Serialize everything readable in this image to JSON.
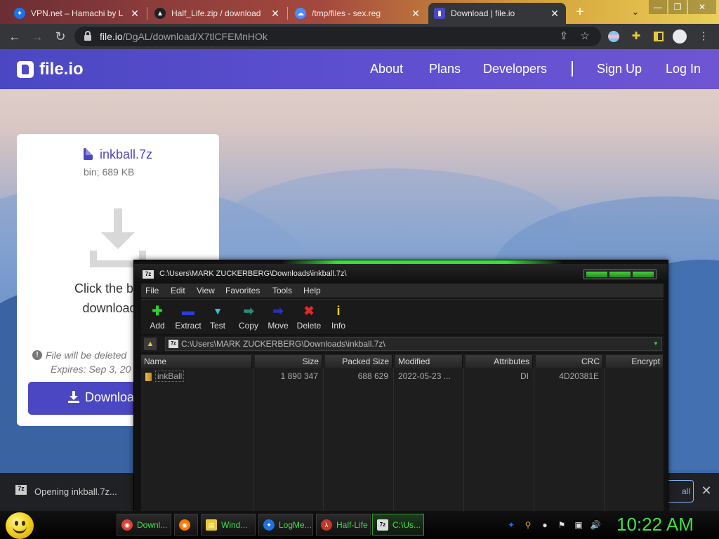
{
  "browser": {
    "tabs": [
      {
        "title": "VPN.net – Hamachi by L",
        "color": "#1a73e8",
        "glyph": "✦"
      },
      {
        "title": "Half_Life.zip / download",
        "color": "#202124",
        "glyph": "▲"
      },
      {
        "title": "/tmp/files - sex.reg",
        "color": "#4a8cff",
        "glyph": "☁"
      },
      {
        "title": "Download | file.io",
        "color": "#4b47c2",
        "glyph": "▮"
      }
    ],
    "new_tab": "+",
    "url_host": "file.io",
    "url_path": "/DgAL/download/X7tlCFEMnHOk"
  },
  "fileio": {
    "brand": "file.io",
    "nav": {
      "about": "About",
      "plans": "Plans",
      "developers": "Developers",
      "signup": "Sign Up",
      "login": "Log In"
    },
    "file_name": "inkball.7z",
    "file_meta": "bin; 689 KB",
    "click_text": "Click the button\ndownload yo",
    "delete_note": "File will be deleted",
    "expires": "Expires: Sep 3, 20",
    "download_btn": "Download"
  },
  "shelf": {
    "item": "Opening inkball.7z...",
    "show_all": "all",
    "close": "✕"
  },
  "sevenzip": {
    "title": "C:\\Users\\MARK ZUCKERBERG\\Downloads\\inkball.7z\\",
    "menu": [
      "File",
      "Edit",
      "View",
      "Favorites",
      "Tools",
      "Help"
    ],
    "tools": [
      {
        "label": "Add",
        "icon": "plus-icon",
        "glyph": "✚",
        "color": "#2fd12f"
      },
      {
        "label": "Extract",
        "icon": "extract-icon",
        "glyph": "▬",
        "color": "#2b3ed6"
      },
      {
        "label": "Test",
        "icon": "test-icon",
        "glyph": "▼",
        "color": "#2bc9d8"
      },
      {
        "label": "Copy",
        "icon": "copy-icon",
        "glyph": "➡",
        "color": "#2a8a7a"
      },
      {
        "label": "Move",
        "icon": "move-icon",
        "glyph": "➡",
        "color": "#2b2fb8"
      },
      {
        "label": "Delete",
        "icon": "delete-icon",
        "glyph": "✖",
        "color": "#e02a2a"
      },
      {
        "label": "Info",
        "icon": "info-icon",
        "glyph": "i",
        "color": "#f0d400"
      }
    ],
    "path": "C:\\Users\\MARK ZUCKERBERG\\Downloads\\inkball.7z\\",
    "columns": [
      "Name",
      "Size",
      "Packed Size",
      "Modified",
      "Attributes",
      "CRC",
      "Encrypt"
    ],
    "rows": [
      {
        "name": "inkBall",
        "size": "1 890 347",
        "packed": "688 629",
        "modified": "2022-05-23 ...",
        "attributes": "DI",
        "crc": "4D20381E",
        "encrypted": ""
      }
    ]
  },
  "taskbar": {
    "tasks": [
      {
        "label": "Downl...",
        "color": "#db4437",
        "glyph": "◉"
      },
      {
        "label": "",
        "color": "#ff7a00",
        "glyph": "◉"
      },
      {
        "label": "Wind...",
        "color": "#e6c93a",
        "glyph": "▤"
      },
      {
        "label": "LogMe...",
        "color": "#1a73e8",
        "glyph": "✦"
      },
      {
        "label": "Half-Life",
        "color": "#c0392b",
        "glyph": "λ"
      },
      {
        "label": "C:\\Us...",
        "color": "#dddddd",
        "glyph": "7z"
      }
    ],
    "clock": "10:22 AM"
  }
}
